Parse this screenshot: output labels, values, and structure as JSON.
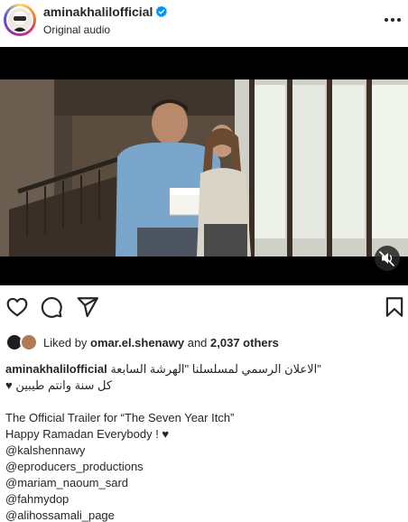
{
  "header": {
    "username": "aminakhalilofficial",
    "subtitle": "Original audio",
    "verified_icon": "verified-badge-icon",
    "more_icon": "more-options-icon"
  },
  "video": {
    "muted": true,
    "mute_icon": "speaker-muted-icon"
  },
  "actions": {
    "like_icon": "heart-icon",
    "comment_icon": "comment-icon",
    "share_icon": "paper-plane-icon",
    "save_icon": "bookmark-icon"
  },
  "likes": {
    "prefix": "Liked by ",
    "user": "omar.el.shenawy",
    "middle": " and ",
    "others": "2,037 others"
  },
  "caption": {
    "username": "aminakhalilofficial",
    "line1_arabic": "\"الاعلان الرسمي لمسلسلنا \"الهرشة السابعة",
    "line2_arabic": "كل سنة وانتم طيبين ♥",
    "line3": "The Official Trailer for “The Seven Year Itch”",
    "line4": "Happy Ramadan Everybody ! ♥",
    "mentions": [
      "@kalshennawy",
      "@eproducers_productions",
      "@mariam_naoum_sard",
      "@fahmydop",
      "@alihossamali_page"
    ]
  }
}
